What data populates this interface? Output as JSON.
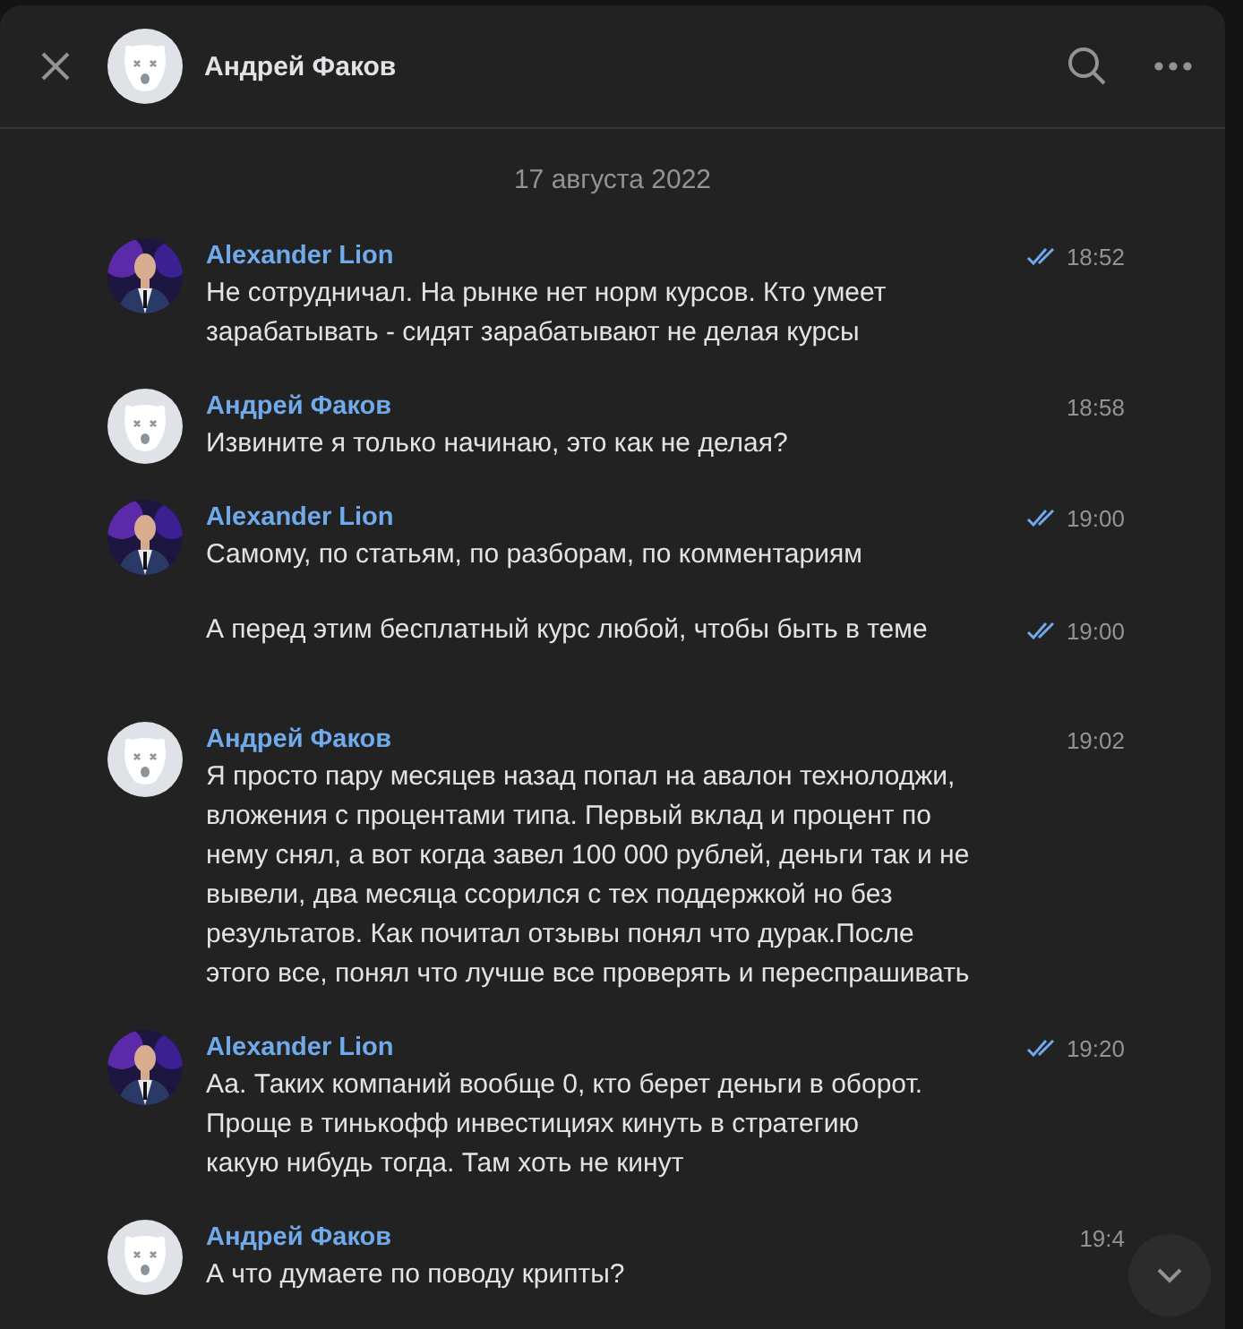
{
  "header": {
    "title": "Андрей Факов"
  },
  "date": "17 августа 2022",
  "messages": [
    {
      "author": "Alexander Lion",
      "time": "18:52",
      "read": true,
      "text": "Не сотрудничал. На рынке нет норм курсов. Кто умеет\nзарабатывать - сидят зарабатывают не делая курсы"
    },
    {
      "author": "Андрей Факов",
      "avatar": {
        "kind": "default"
      },
      "time": "18:58",
      "read": false,
      "text": "Извините я только начинаю, это как не делая?"
    },
    {
      "author": "Alexander Lion",
      "time": "19:00",
      "read": true,
      "text": "Самому, по статьям, по разборам, по комментариям"
    },
    {
      "time": "19:00",
      "read": true,
      "text": "А перед этим бесплатный курс любой, чтобы быть в теме"
    },
    {
      "author": "Андрей Факов",
      "avatar": {
        "kind": "default"
      },
      "time": "19:02",
      "read": false,
      "text": "Я просто пару месяцев назад попал на авалон технолоджи,\nвложения с процентами типа. Первый вклад и процент по\nнему снял, а вот когда завел 100 000 рублей, деньги так и не\nвывели, два месяца ссорился с тех поддержкой но без\nрезультатов. Как почитал отзывы понял что дурак.После\nэтого все, понял что лучше все проверять и переспрашивать"
    },
    {
      "author": "Alexander Lion",
      "time": "19:20",
      "read": true,
      "text": "Аа. Таких компаний вообще 0, кто берет деньги в оборот.\nПроще в тинькофф инвестициях кинуть в стратегию\nкакую нибудь тогда. Там хоть не кинут"
    },
    {
      "author": "Андрей Факов",
      "avatar": {
        "kind": "default"
      },
      "time": "19:4",
      "read": false,
      "text": "А что думаете по поводу крипты?"
    }
  ]
}
